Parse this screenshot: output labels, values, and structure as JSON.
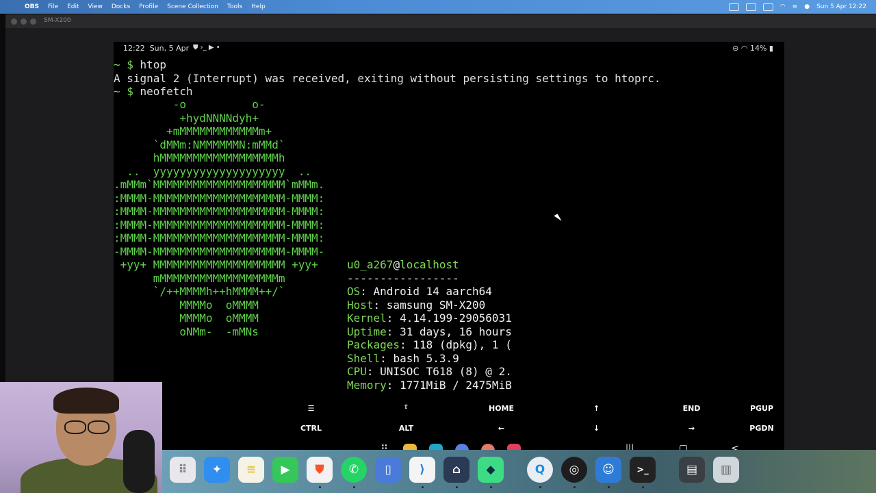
{
  "menubar": {
    "app": "OBS",
    "items": [
      "File",
      "Edit",
      "View",
      "Docks",
      "Profile",
      "Scene Collection",
      "Tools",
      "Help"
    ],
    "datetime": "Sun 5 Apr  12:22"
  },
  "window": {
    "title": "SM-X200"
  },
  "status": {
    "time": "12:22",
    "date": "Sun, 5 Apr",
    "battery": "14%"
  },
  "terminal": {
    "lines": [
      {
        "prompt": "~ $ ",
        "text": "htop"
      },
      {
        "prompt": "",
        "text": "A signal 2 (Interrupt) was received, exiting without persisting settings to htoprc."
      },
      {
        "prompt": "~ $ ",
        "text": "neofetch"
      }
    ],
    "logo": "         -o          o-\n          +hydNNNNdyh+\n        +mMMMMMMMMMMMMm+\n      `dMMm:NMMMMMMN:mMMd`\n      hMMMMMMMMMMMMMMMMMMh\n  ..  yyyyyyyyyyyyyyyyyyyy  ..\n.mMMm`MMMMMMMMMMMMMMMMMMMM`mMMm.\n:MMMM-MMMMMMMMMMMMMMMMMMMM-MMMM:\n:MMMM-MMMMMMMMMMMMMMMMMMMM-MMMM:\n:MMMM-MMMMMMMMMMMMMMMMMMMM-MMMM:\n:MMMM-MMMMMMMMMMMMMMMMMMMM-MMMM:\n-MMMM-MMMMMMMMMMMMMMMMMMMM-MMMM-\n +yy+ MMMMMMMMMMMMMMMMMMMM +yy+\n      mMMMMMMMMMMMMMMMMMMm\n      `/++MMMMh++hMMMM++/`\n          MMMMo  oMMMM\n          MMMMo  oMMMM\n          oNMm-  -mMNs",
    "user": "u0_a267",
    "host": "localhost",
    "separator": "-----------------",
    "info": [
      {
        "key": "OS",
        "value": "Android 14 aarch64"
      },
      {
        "key": "Host",
        "value": "samsung SM-X200"
      },
      {
        "key": "Kernel",
        "value": "4.14.199-29056031"
      },
      {
        "key": "Uptime",
        "value": "31 days, 16 hours"
      },
      {
        "key": "Packages",
        "value": "118 (dpkg), 1 ("
      },
      {
        "key": "Shell",
        "value": "bash 5.3.9"
      },
      {
        "key": "CPU",
        "value": "UNISOC T618 (8) @ 2."
      },
      {
        "key": "Memory",
        "value": "1771MiB / 2475MiB"
      }
    ]
  },
  "extra_keys": {
    "row1": [
      "",
      "☰",
      "⇧",
      "HOME",
      "↑",
      "END",
      "PGUP"
    ],
    "row2": [
      "",
      "CTRL",
      "ALT",
      "←",
      "↓",
      "→",
      "PGDN"
    ]
  },
  "navbar": {
    "recent": "|||",
    "home": "▢",
    "back": "<"
  },
  "dock": [
    "Launchpad",
    "Safari",
    "Notes",
    "FaceTime",
    "Brave",
    "WhatsApp",
    "Preview",
    "VS Code",
    "Instruments",
    "Android Studio",
    "QuickTime",
    "OBS",
    "Finder",
    "Terminal",
    "Downloads",
    "Trash"
  ]
}
